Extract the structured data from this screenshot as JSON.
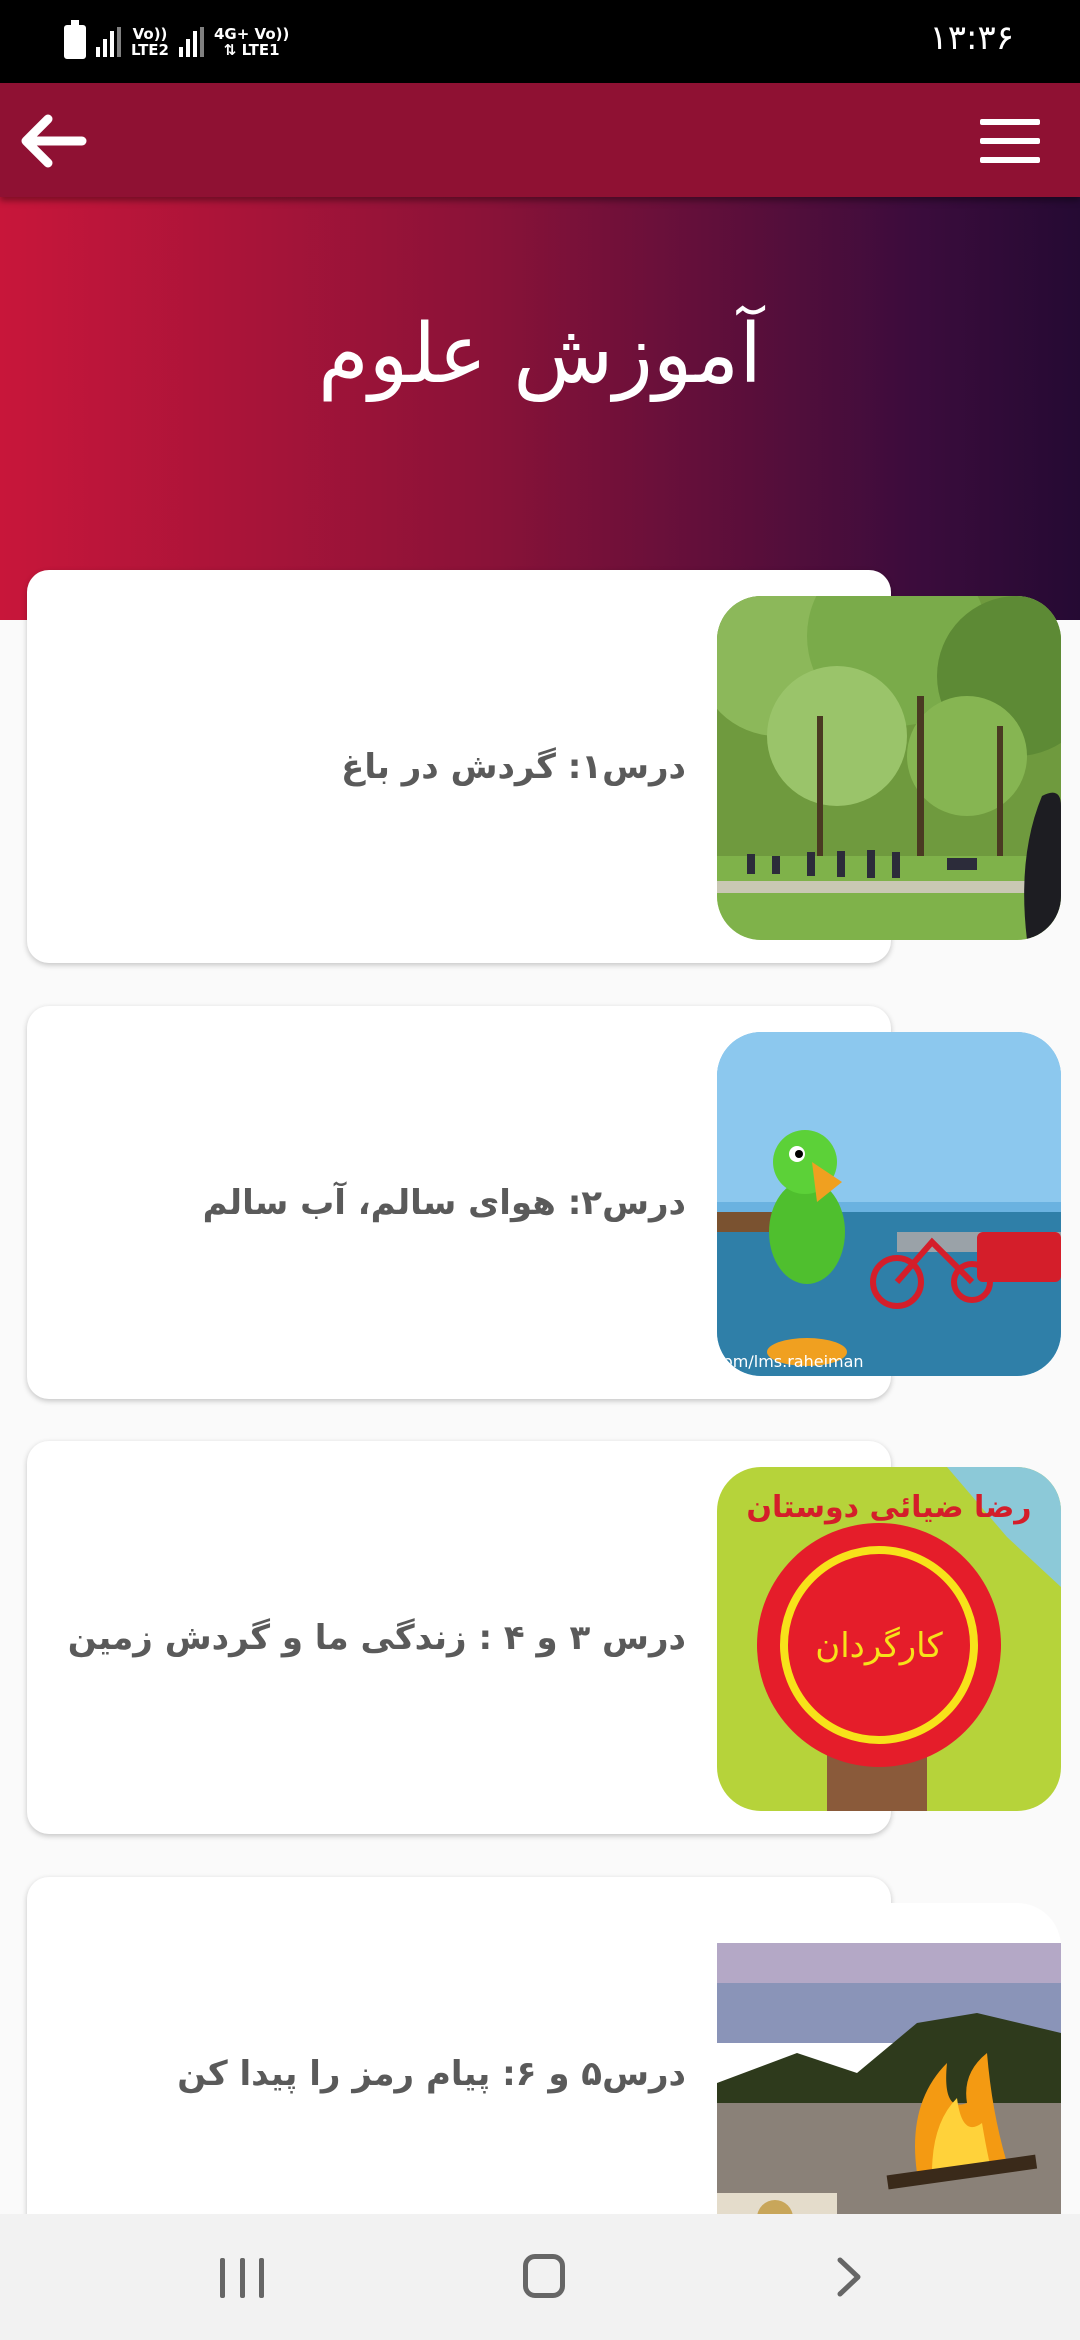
{
  "status_bar": {
    "time": "۱۳:۳۶",
    "sim1": {
      "top": "Vo))",
      "bottom": "LTE2"
    },
    "sim2": {
      "top": "4G+ Vo))",
      "bottom": "⇅ LTE1"
    }
  },
  "header": {
    "title": "آموزش علوم"
  },
  "lessons": [
    {
      "title": "درس۱: گردش در باغ",
      "image": "park-scene"
    },
    {
      "title": "درس۲: هوای سالم، آب سالم",
      "image": "parrot-cartoon",
      "watermark": "om/lms.raheiman"
    },
    {
      "title": "درس ۳ و ۴ : زندگی ما و گردش زمین",
      "image": "director-badge",
      "image_text": "کارگردان",
      "image_arc_text": "رضا ضیائی دوستان"
    },
    {
      "title": "درس۵ و ۶: پیام رمز را پیدا کن",
      "image": "campfire-scene"
    }
  ],
  "colors": {
    "app_bar": "#8f1133",
    "hero_gradient_start": "#c8163a",
    "hero_gradient_end": "#250a33",
    "card_text": "#5a5a5a"
  },
  "icons": {
    "back": "arrow-left-icon",
    "menu": "hamburger-menu-icon",
    "nav_recent": "recent-apps-icon",
    "nav_home": "home-icon",
    "nav_back": "chevron-right-icon"
  }
}
